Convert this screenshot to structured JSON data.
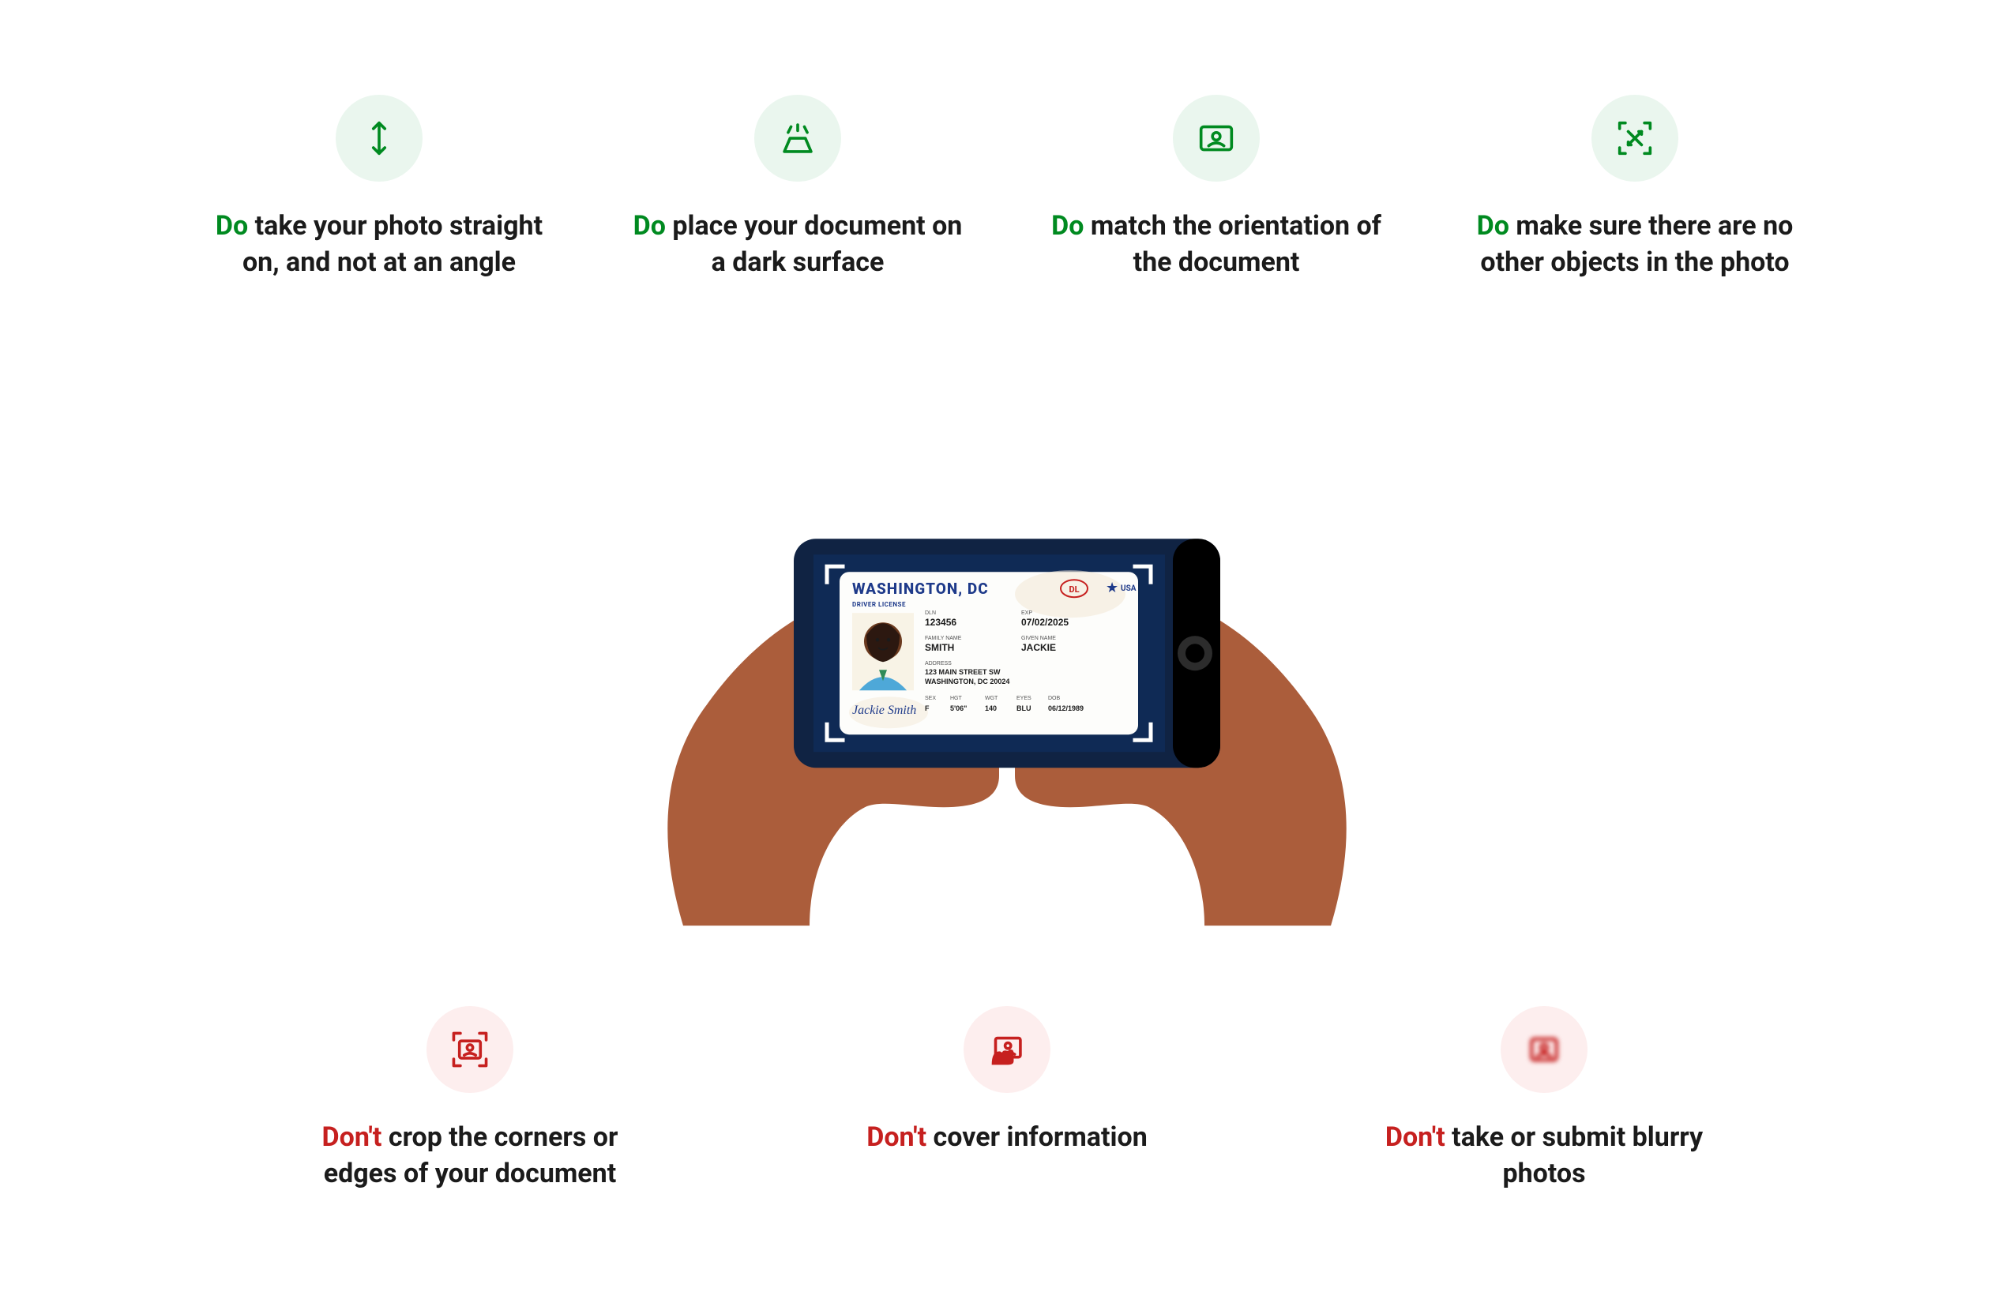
{
  "dos": [
    {
      "kw": "Do",
      "rest": " take your photo straight on, and not at an angle"
    },
    {
      "kw": "Do",
      "rest": " place your document on a dark surface"
    },
    {
      "kw": "Do",
      "rest": " match the orientation of the document"
    },
    {
      "kw": "Do",
      "rest": " make sure there are no other objects in the photo"
    }
  ],
  "donts": [
    {
      "kw": "Don't",
      "rest": " crop the corners or edges of your document"
    },
    {
      "kw": "Don't",
      "rest": " cover information"
    },
    {
      "kw": "Don't",
      "rest": " take or submit blurry photos"
    }
  ],
  "id_card": {
    "state": "WASHINGTON, DC",
    "badge": "DL",
    "country": "USA",
    "doc_type": "DRIVER LICENSE",
    "labels": {
      "dln": "DLN",
      "exp": "EXP",
      "family": "FAMILY NAME",
      "given": "GIVEN NAME",
      "address": "ADDRESS",
      "sex": "SEX",
      "hgt": "HGT",
      "wgt": "WGT",
      "eyes": "EYES",
      "dob": "DOB"
    },
    "dln": "123456",
    "exp": "07/02/2025",
    "family_name": "SMITH",
    "given_name": "JACKIE",
    "address_line1": "123 MAIN STREET SW",
    "address_line2": "WASHINGTON, DC 20024",
    "sex": "F",
    "hgt": "5'06\"",
    "wgt": "140",
    "eyes": "BLU",
    "dob": "06/12/1989",
    "signature": "Jackie Smith"
  },
  "colors": {
    "do": "#008a20",
    "dont": "#c6201f"
  }
}
